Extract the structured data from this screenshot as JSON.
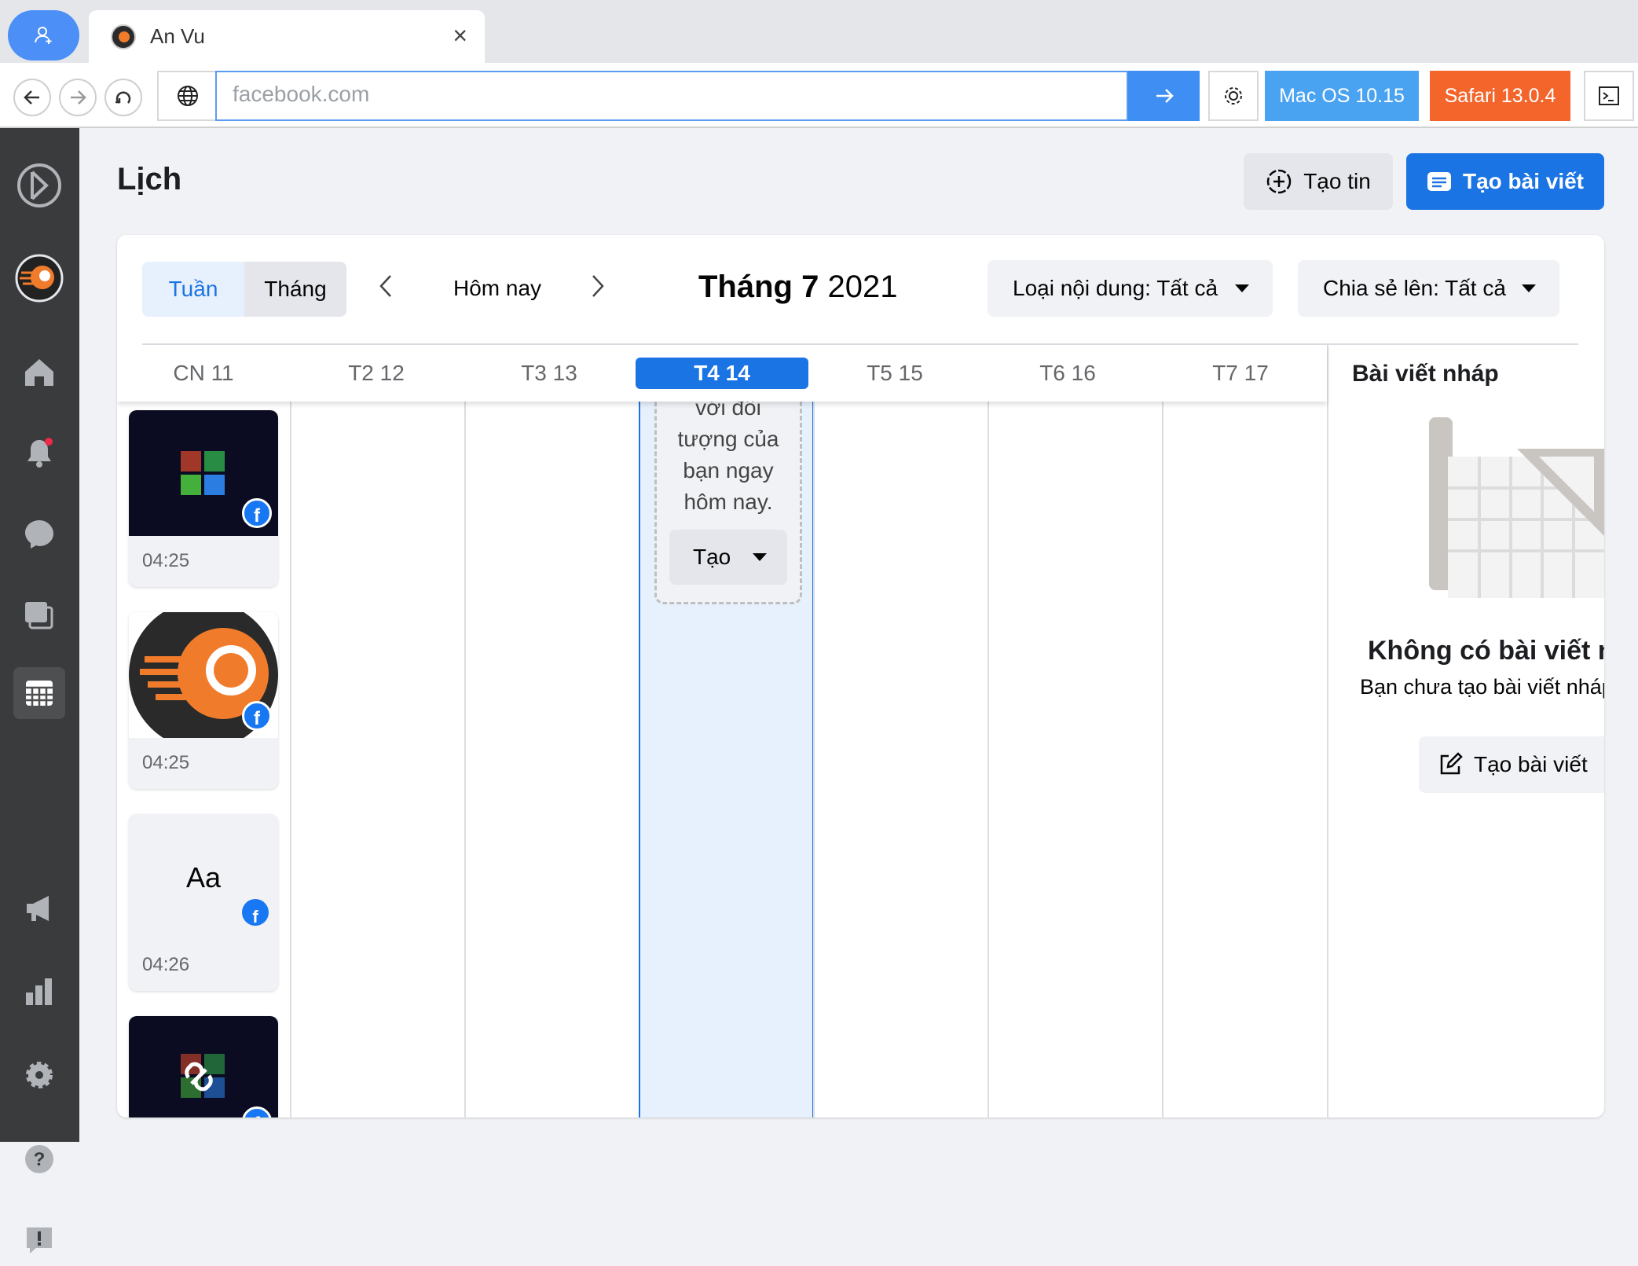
{
  "browser": {
    "tab_title": "An Vu",
    "url": "facebook.com",
    "os_badge": "Mac OS 10.15",
    "browser_badge": "Safari 13.0.4"
  },
  "colors": {
    "accent": "#1b74e4",
    "os_badge": "#4aa3f0",
    "browser_badge": "#f3652b",
    "nav_bg": "#3a3b3c"
  },
  "sidebar": {
    "icons": [
      "logo-icon",
      "page-avatar",
      "home-icon",
      "notifications-icon",
      "inbox-icon",
      "content-library-icon",
      "planner-icon",
      "ads-icon",
      "insights-icon",
      "settings-icon",
      "help-icon",
      "report-icon"
    ]
  },
  "header": {
    "title": "Lịch",
    "create_story": "Tạo tin",
    "create_post": "Tạo bài viết"
  },
  "toolbar": {
    "week": "Tuần",
    "month": "Tháng",
    "today": "Hôm nay",
    "month_title_bold": "Tháng 7",
    "month_title_year": "2021",
    "content_filter": "Loại nội dung: Tất cả",
    "share_filter": "Chia sẻ lên: Tất cả"
  },
  "days": [
    "CN 11",
    "T2 12",
    "T3 13",
    "T4 14",
    "T5 15",
    "T6 16",
    "T7 17"
  ],
  "selected_day": "T4 14",
  "placeholder": {
    "text": "với đối\ntượng của\nbạn ngay\nhôm nay.",
    "create": "Tạo"
  },
  "posts": [
    {
      "time": "04:25",
      "thumb": "app-grid"
    },
    {
      "time": "04:25",
      "thumb": "lion-logo"
    },
    {
      "time": "04:26",
      "thumb": "text",
      "text": "Aa"
    },
    {
      "time": "",
      "thumb": "link-grid"
    }
  ],
  "drafts": {
    "title": "Bài viết nháp",
    "empty_title": "Không có bài viết nháp",
    "empty_desc": "Bạn chưa tạo bài viết nháp nào",
    "create": "Tạo bài viết"
  }
}
